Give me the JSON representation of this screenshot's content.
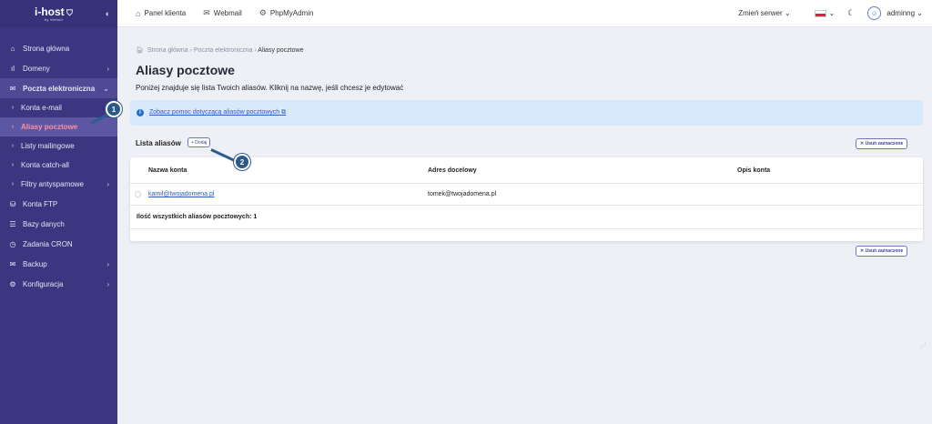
{
  "brand": {
    "name": "i-host",
    "tagline": "by Websit"
  },
  "sidebar": {
    "items": [
      {
        "label": "Strona główna",
        "icon": "home-icon",
        "glyph": "⌂"
      },
      {
        "label": "Domeny",
        "icon": "chart-icon",
        "glyph": "ıl"
      },
      {
        "label": "Poczta elektroniczna",
        "icon": "mail-icon",
        "glyph": "✉"
      },
      {
        "label": "Konta e-mail"
      },
      {
        "label": "Aliasy pocztowe"
      },
      {
        "label": "Listy mailingowe"
      },
      {
        "label": "Konta catch-all"
      },
      {
        "label": "Filtry antyspamowe"
      },
      {
        "label": "Konta FTP",
        "icon": "ftp-icon",
        "glyph": "⛁"
      },
      {
        "label": "Bazy danych",
        "icon": "database-icon",
        "glyph": "☰"
      },
      {
        "label": "Zadania CRON",
        "icon": "clock-icon",
        "glyph": "◷"
      },
      {
        "label": "Backup",
        "icon": "backup-icon",
        "glyph": "✉"
      },
      {
        "label": "Konfiguracja",
        "icon": "gear-icon",
        "glyph": "⚙"
      }
    ]
  },
  "topbar": {
    "links": [
      "Panel klienta",
      "Webmail",
      "PhpMyAdmin"
    ],
    "server": "Zmień serwer",
    "user": "adminng"
  },
  "page": {
    "breadcrumb": [
      "Strona główna",
      "Poczta elektroniczna",
      "Aliasy pocztowe"
    ],
    "title": "Aliasy pocztowe",
    "lead": "Poniżej znajduje się lista Twoich aliasów. Kliknij na nazwę, jeśli chcesz je edytować",
    "info_link": "Zobacz pomoc dotyczącą aliasów pocztowych",
    "list_title": "Lista aliasów",
    "add_label": "+ Dodaj",
    "delete_label": "✕ Usuń zaznaczone"
  },
  "table": {
    "headers": [
      "Nazwa konta",
      "Adres docelowy",
      "Opis konta"
    ],
    "rows": [
      {
        "account": "kamil@twojadomena.pl",
        "target": "tomek@twojadomena.pl",
        "desc": ""
      }
    ],
    "total": "Ilość wszystkich aliasów pocztowych: 1"
  },
  "callouts": [
    "1",
    "2"
  ],
  "colors": {
    "sidebar": "#3a3780",
    "active": "#ff8fa0",
    "accent": "#3c3f99",
    "info_bg": "#d7e9fa",
    "callout": "#2b5a8a"
  }
}
